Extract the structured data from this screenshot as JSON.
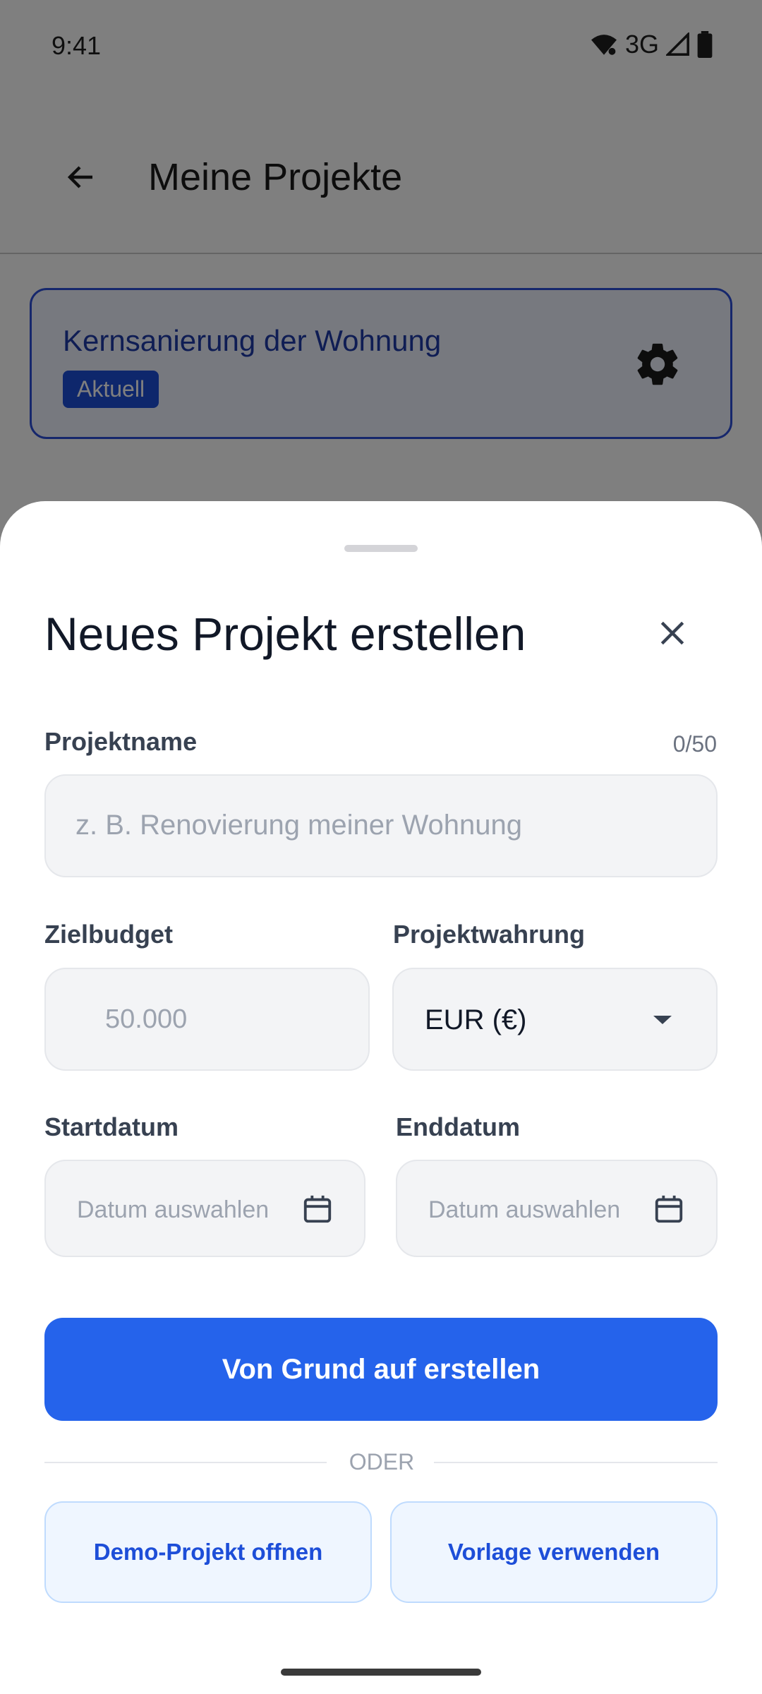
{
  "status_bar": {
    "time": "9:41",
    "network": "3G"
  },
  "app_bar": {
    "title": "Meine Projekte"
  },
  "project_card": {
    "title": "Kernsanierung der Wohnung",
    "badge": "Aktuell"
  },
  "sheet": {
    "title": "Neues Projekt erstellen",
    "project_name": {
      "label": "Projektname",
      "counter": "0/50",
      "placeholder": "z. B. Renovierung meiner Wohnung"
    },
    "budget": {
      "label": "Zielbudget",
      "placeholder": "50.000"
    },
    "currency": {
      "label": "Projektwahrung",
      "selected": "EUR (€)"
    },
    "start_date": {
      "label": "Startdatum",
      "placeholder": "Datum auswahlen"
    },
    "end_date": {
      "label": "Enddatum",
      "placeholder": "Datum auswahlen"
    },
    "create_button": "Von Grund auf erstellen",
    "divider": "ODER",
    "demo_button": "Demo-Projekt offnen",
    "template_button": "Vorlage verwenden"
  },
  "colors": {
    "primary": "#2563eb",
    "field_bg": "#f3f4f6",
    "secondary_bg": "#eff6ff",
    "secondary_text": "#1d4ed8"
  }
}
